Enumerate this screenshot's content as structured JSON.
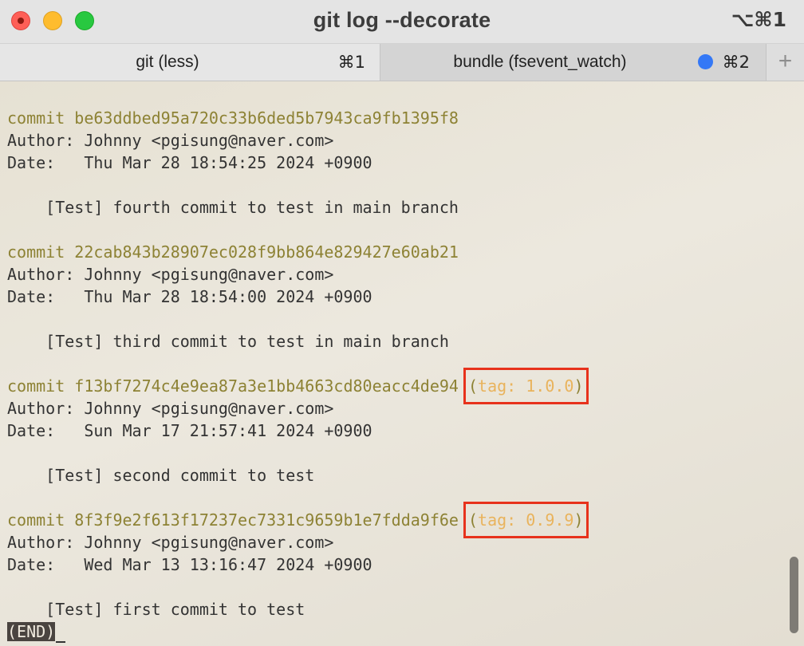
{
  "window": {
    "title": "git log --decorate",
    "shortcut": "⌥⌘1"
  },
  "tabs": [
    {
      "label": "git (less)",
      "shortcut": "⌘1",
      "active": true
    },
    {
      "label": "bundle (fsevent_watch)",
      "shortcut": "⌘2",
      "active": false,
      "indicator_color": "#3478f6"
    }
  ],
  "new_tab_label": "+",
  "commit_keyword": "commit",
  "commits": [
    {
      "hash": "be63ddbed95a720c33b6ded5b7943ca9fb1395f8",
      "author_line": "Author: Johnny <pgisung@naver.com>",
      "date_line": "Date:   Thu Mar 28 18:54:25 2024 +0900",
      "message": "    [Test] fourth commit to test in main branch"
    },
    {
      "hash": "22cab843b28907ec028f9bb864e829427e60ab21",
      "author_line": "Author: Johnny <pgisung@naver.com>",
      "date_line": "Date:   Thu Mar 28 18:54:00 2024 +0900",
      "message": "    [Test] third commit to test in main branch"
    },
    {
      "hash": "f13bf7274c4e9ea87a3e1bb4663cd80eacc4de94",
      "tag": "tag: 1.0.0",
      "author_line": "Author: Johnny <pgisung@naver.com>",
      "date_line": "Date:   Sun Mar 17 21:57:41 2024 +0900",
      "message": "    [Test] second commit to test"
    },
    {
      "hash": "8f3f9e2f613f17237ec7331c9659b1e7fdda9f6e",
      "tag": "tag: 0.9.9",
      "author_line": "Author: Johnny <pgisung@naver.com>",
      "date_line": "Date:   Wed Mar 13 13:16:47 2024 +0900",
      "message": "    [Test] first commit to test"
    }
  ],
  "pager_prompt": "(END)",
  "colors": {
    "commit_hash": "#8d8234",
    "tag_text": "#e9b35c",
    "highlight_box": "#e7321c",
    "active_tab_indicator": "#3478f6"
  }
}
